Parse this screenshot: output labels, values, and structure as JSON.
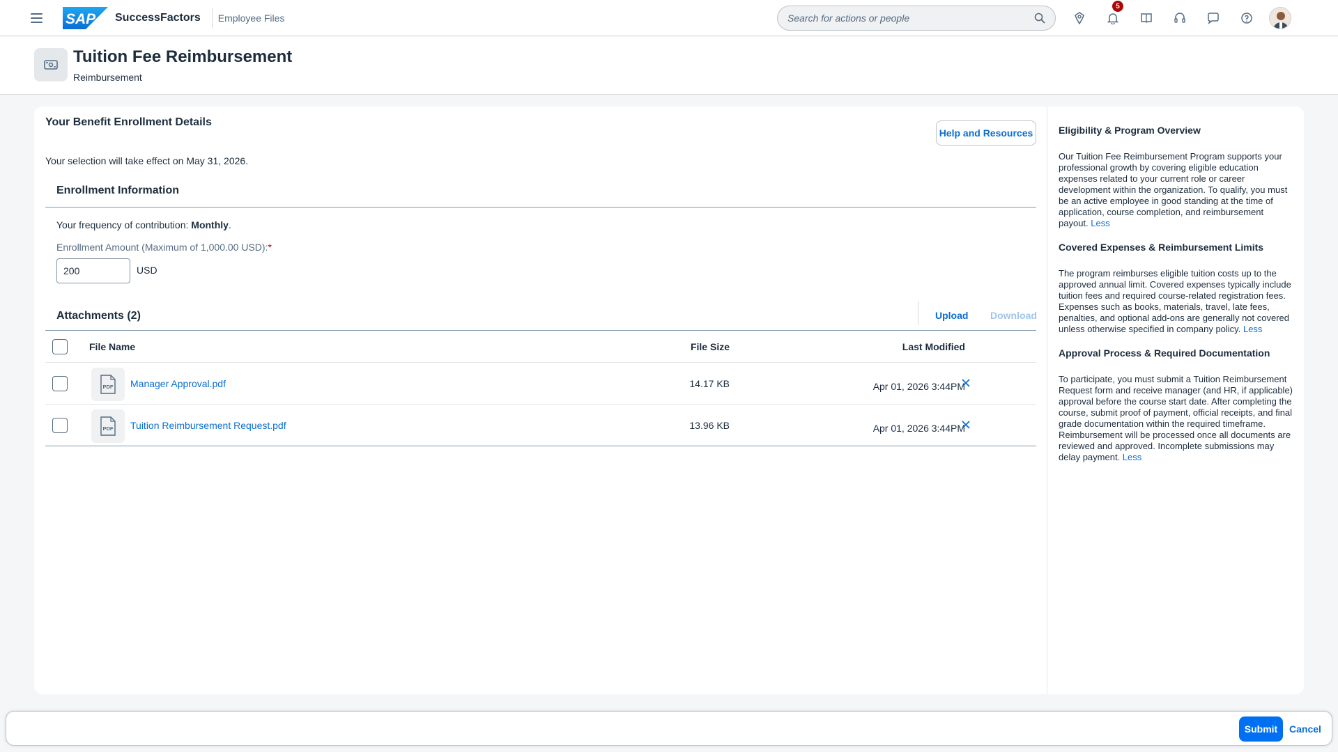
{
  "shell": {
    "brand_logo_text": "SAP",
    "product_name": "SuccessFactors",
    "section": "Employee Files",
    "search_placeholder": "Search for actions or people",
    "notification_count": "5",
    "colors": {
      "brand": "#0a6ed1",
      "badge": "#aa0808"
    },
    "icons": [
      "menu-icon",
      "search-icon",
      "pin-icon",
      "bell-icon",
      "book-icon",
      "headset-icon",
      "chat-icon",
      "help-icon"
    ]
  },
  "page": {
    "title": "Tuition Fee Reimbursement",
    "subtitle": "Reimbursement",
    "icon": "reimbursement-icon"
  },
  "details": {
    "section_title": "Your Benefit Enrollment Details",
    "help_button": "Help and Resources",
    "effect_text": "Your selection will take effect on May 31, 2026.",
    "enrollment": {
      "heading": "Enrollment Information",
      "freq_prefix": "Your frequency of contribution: ",
      "freq_value": "Monthly",
      "freq_suffix": ".",
      "amount_label": "Enrollment Amount (Maximum of 1,000.00 USD):",
      "required_marker": "*",
      "amount_value": "200",
      "amount_unit": "USD"
    },
    "attachments": {
      "title": "Attachments (2)",
      "upload": "Upload",
      "download": "Download",
      "columns": [
        "File Name",
        "File Size",
        "Last Modified"
      ],
      "rows": [
        {
          "thumb": "PDF",
          "name": "Manager Approval.pdf",
          "size": "14.17 KB",
          "modified": "Apr 01, 2026 3:44PM"
        },
        {
          "thumb": "PDF",
          "name": "Tuition Reimbursement Request.pdf",
          "size": "13.96 KB",
          "modified": "Apr 01, 2026 3:44PM"
        }
      ]
    }
  },
  "sidebar": {
    "sections": [
      {
        "title": "Eligibility & Program Overview",
        "text": "Our Tuition Fee Reimbursement Program supports your professional growth by covering eligible education expenses related to your current role or career development within the organization. To qualify, you must be an active employee in good standing at the time of application, course completion, and reimbursement payout.",
        "link": "Less"
      },
      {
        "title": "Covered Expenses & Reimbursement Limits",
        "text": "The program reimburses eligible tuition costs up to the approved annual limit. Covered expenses typically include tuition fees and required course-related registration fees. Expenses such as books, materials, travel, late fees, penalties, and optional add-ons are generally not covered unless otherwise specified in company policy.",
        "link": "Less"
      },
      {
        "title": "Approval Process & Required Documentation",
        "text": "To participate, you must submit a Tuition Reimbursement Request form and receive manager (and HR, if applicable) approval before the course start date. After completing the course, submit proof of payment, official receipts, and final grade documentation within the required timeframe. Reimbursement will be processed once all documents are reviewed and approved. Incomplete submissions may delay payment.",
        "link": "Less"
      }
    ]
  },
  "footer": {
    "submit": "Submit",
    "cancel": "Cancel"
  }
}
